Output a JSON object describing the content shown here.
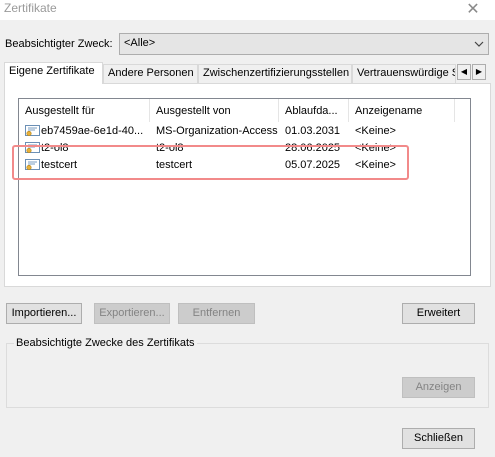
{
  "window": {
    "title": "Zertifikate",
    "close_glyph": "✕"
  },
  "purpose": {
    "label": "Beabsichtigter Zweck:",
    "value": "<Alle>"
  },
  "tabs": [
    {
      "label": "Eigene Zertifikate"
    },
    {
      "label": "Andere Personen"
    },
    {
      "label": "Zwischenzertifizierungsstellen"
    },
    {
      "label": "Vertrauenswürdige Stamm"
    }
  ],
  "tab_scroll": {
    "left": "◀",
    "right": "▶"
  },
  "list": {
    "columns": [
      "Ausgestellt für",
      "Ausgestellt von",
      "Ablaufda...",
      "Anzeigename"
    ],
    "rows": [
      {
        "issued_to": "eb7459ae-6e1d-40...",
        "issued_by": "MS-Organization-Access",
        "expires": "01.03.2031",
        "friendly_name": "<Keine>"
      },
      {
        "issued_to": "t2-ol8",
        "issued_by": "t2-ol8",
        "expires": "28.06.2025",
        "friendly_name": "<Keine>"
      },
      {
        "issued_to": "testcert",
        "issued_by": "testcert",
        "expires": "05.07.2025",
        "friendly_name": "<Keine>"
      }
    ]
  },
  "buttons": {
    "import": "Importieren...",
    "export": "Exportieren...",
    "remove": "Entfernen",
    "advanced": "Erweitert",
    "view": "Anzeigen",
    "close": "Schließen"
  },
  "purposes_group": {
    "label": "Beabsichtigte Zwecke des Zertifikats"
  },
  "colors": {
    "highlight": "#f28a8a",
    "disabled_button": "#cccccc"
  },
  "icons": {
    "certificate": "certificate-icon"
  }
}
